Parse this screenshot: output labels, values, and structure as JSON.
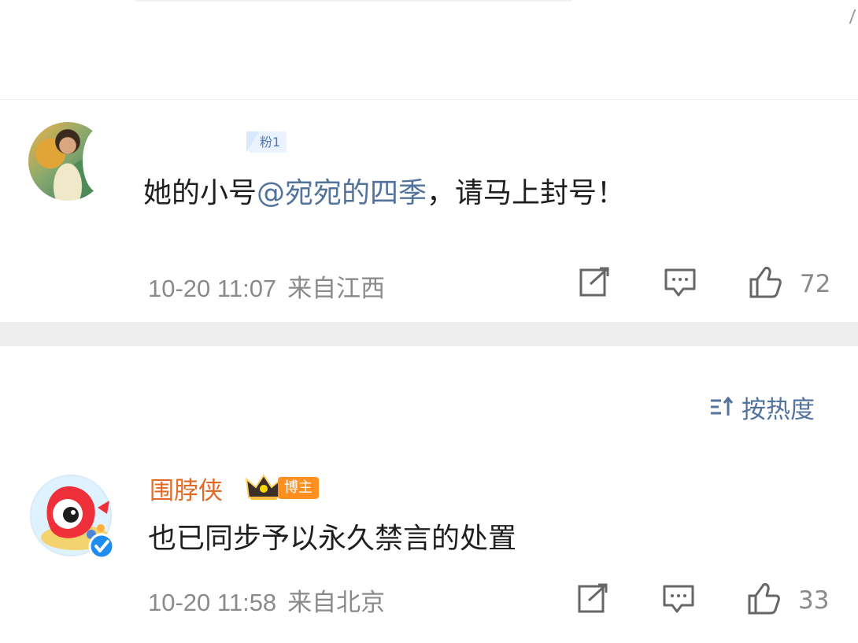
{
  "comments": [
    {
      "badge": "粉1",
      "text_prefix": "她的小号",
      "mention": "@宛宛的四季",
      "text_suffix": "，请马上封号！",
      "time": "10-20 11:07",
      "location": "来自江西",
      "likes": "72"
    },
    {
      "name": "围脖侠",
      "badge": "博主",
      "text": "也已同步予以永久禁言的处置",
      "time": "10-20 11:58",
      "location": "来自北京",
      "likes": "33"
    }
  ],
  "sort": {
    "label": "按热度"
  },
  "icons": {
    "share": "share-icon",
    "comment": "comment-icon",
    "like": "like-icon",
    "sort": "sort-icon",
    "crown": "crown-icon",
    "verified": "verified-icon"
  },
  "colors": {
    "mention": "#52739d",
    "username_orange": "#e06a26",
    "badge_orange": "#ff8f1f",
    "meta_gray": "#8a8a8a"
  }
}
